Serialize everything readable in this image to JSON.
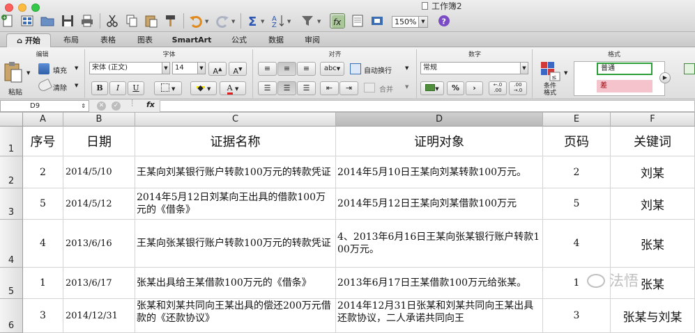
{
  "window": {
    "title": "工作簿2"
  },
  "toolbar": {
    "zoom": "150%"
  },
  "tabs": [
    {
      "label": "开始",
      "active": true
    },
    {
      "label": "布局"
    },
    {
      "label": "表格"
    },
    {
      "label": "图表"
    },
    {
      "label": "SmartArt"
    },
    {
      "label": "公式"
    },
    {
      "label": "数据"
    },
    {
      "label": "审阅"
    }
  ],
  "ribbon": {
    "groups": {
      "edit": "编辑",
      "font": "字体",
      "align": "对齐",
      "number": "数字",
      "format": "格式"
    },
    "paste": "粘贴",
    "fill": "填充",
    "clear": "清除",
    "font_name": "宋体 (正文)",
    "font_size": "14",
    "bold": "B",
    "italic": "I",
    "underline": "U",
    "wrap_text": "自动换行",
    "merge": "合并",
    "abc": "abc",
    "number_format": "常规",
    "percent": "%",
    "comma": "›",
    "dec_inc": "←.0\n.00",
    "dec_dec": ".00\n→.0",
    "cond_format": "条件\n格式",
    "style_normal": "普通",
    "style_bad": "差"
  },
  "formula_bar": {
    "cell_ref": "D9",
    "fx": "fx"
  },
  "grid": {
    "columns": [
      "A",
      "B",
      "C",
      "D",
      "E",
      "F"
    ],
    "selected_column": "D",
    "rows": [
      "1",
      "2",
      "3",
      "4",
      "5",
      "6"
    ],
    "header": [
      "序号",
      "日期",
      "证据名称",
      "证明对象",
      "页码",
      "关键词"
    ],
    "data": [
      [
        "2",
        "2014/5/10",
        "王某向刘某银行账户转款100万元的转款凭证",
        "2014年5月10日王某向刘某转款100万元。",
        "2",
        "刘某"
      ],
      [
        "5",
        "2014/5/12",
        "2014年5月12日刘某向王出具的借款100万元的《借条》",
        "2014年5月12日王某向刘某借款100万元",
        "5",
        "刘某"
      ],
      [
        "4",
        "2013/6/16",
        "王某向张某银行账户转款100万元的转款凭证",
        "4、2013年6月16日王某向张某银行账户转款100万元。",
        "4",
        "张某"
      ],
      [
        "1",
        "2013/6/17",
        "张某出具给王某借款100万元的《借条》",
        "2013年6月17日王某借款100万元给张某。",
        "1",
        "张某"
      ],
      [
        "3",
        "2014/12/31",
        "张某和刘某共同向王某出具的偿还200万元借款的《还款协议》",
        "2014年12月31日张某和刘某共同向王某出具还款协议，二人承诺共同向王",
        "3",
        "张某与刘某"
      ]
    ]
  },
  "watermark": "法悟",
  "colors": {
    "accent_green": "#2b9e3a",
    "bad_fill": "#f5c3cb"
  }
}
